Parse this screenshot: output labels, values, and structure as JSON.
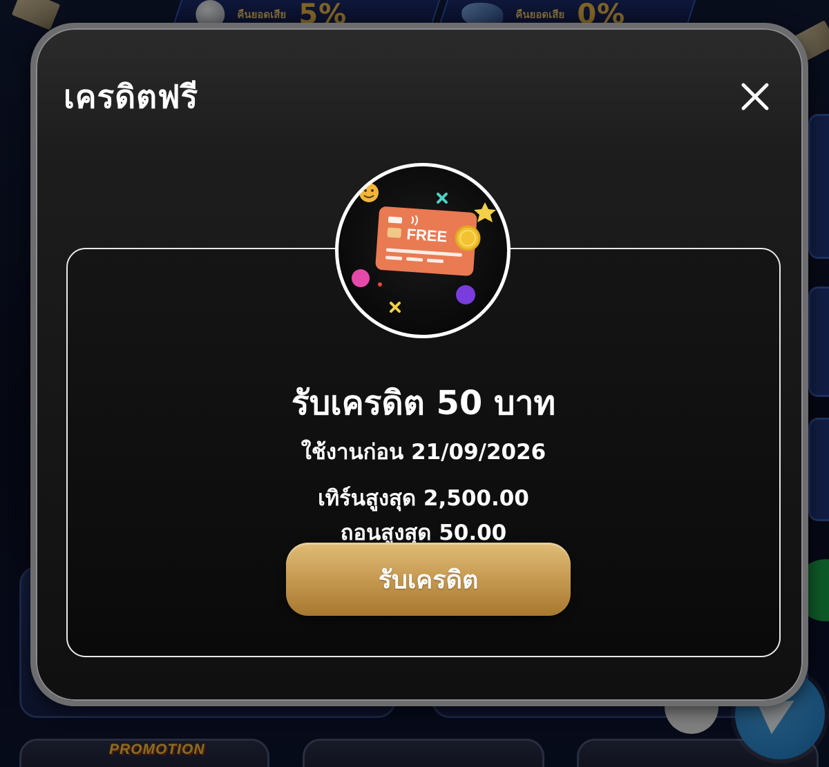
{
  "background": {
    "banner_left_text": "คืนยอดเสีย",
    "banner_left_percent": "5%",
    "banner_right_text": "คืนยอดเสีย",
    "banner_right_percent": "0%",
    "promo_label": "PROMOTION"
  },
  "modal": {
    "title": "เครดิตฟรี",
    "emblem": {
      "card_label": "FREE",
      "icon": "free-credit-card-icon"
    },
    "heading": "รับเครดิต 50 บาท",
    "expiry": "ใช้งานก่อน 21/09/2026",
    "max_turnover": "เทิร์นสูงสุด 2,500.00",
    "max_withdraw": "ถอนสูงสุด 50.00",
    "claim_button_label": "รับเครดิต",
    "close_icon": "close-icon"
  },
  "colors": {
    "modal_bg": "#1d1d1d",
    "modal_border": "#6d6d6f",
    "button_gold": "#c99c54",
    "card_orange": "#ea7a52",
    "text": "#ffffff"
  }
}
